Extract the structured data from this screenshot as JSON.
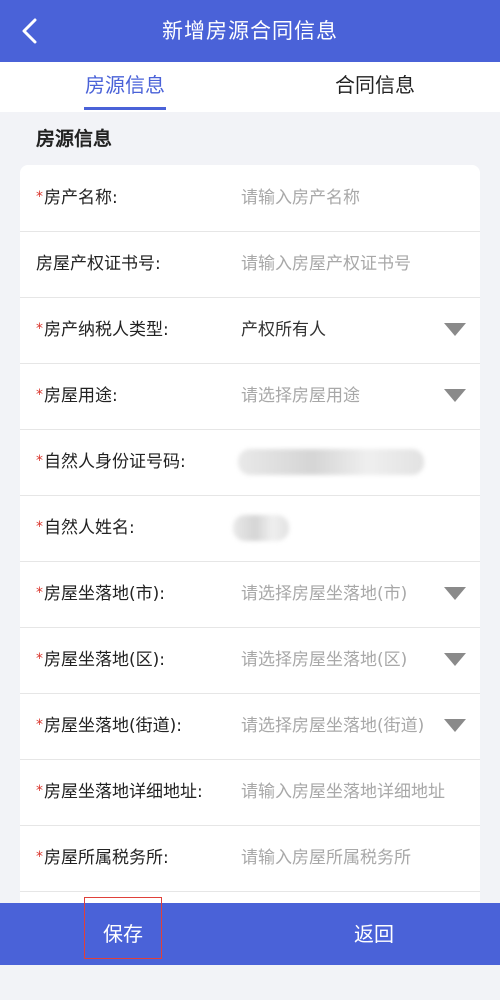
{
  "header": {
    "title": "新增房源合同信息"
  },
  "tabs": [
    {
      "label": "房源信息",
      "active": true
    },
    {
      "label": "合同信息",
      "active": false
    }
  ],
  "section": {
    "title": "房源信息"
  },
  "form": {
    "fields": [
      {
        "label": "房产名称:",
        "required": true,
        "placeholder": "请输入房产名称",
        "value": "",
        "type": "input"
      },
      {
        "label": "房屋产权证书号:",
        "required": false,
        "placeholder": "请输入房屋产权证书号",
        "value": "",
        "type": "input"
      },
      {
        "label": "房产纳税人类型:",
        "required": true,
        "placeholder": "",
        "value": "产权所有人",
        "type": "select"
      },
      {
        "label": "房屋用途:",
        "required": true,
        "placeholder": "请选择房屋用途",
        "value": "",
        "type": "select"
      },
      {
        "label": "自然人身份证号码:",
        "required": true,
        "placeholder": "",
        "value": "",
        "type": "input",
        "obscured": true
      },
      {
        "label": "自然人姓名:",
        "required": true,
        "placeholder": "",
        "value": "",
        "type": "input",
        "obscured": true
      },
      {
        "label": "房屋坐落地(市):",
        "required": true,
        "placeholder": "请选择房屋坐落地(市)",
        "value": "",
        "type": "select"
      },
      {
        "label": "房屋坐落地(区):",
        "required": true,
        "placeholder": "请选择房屋坐落地(区)",
        "value": "",
        "type": "select"
      },
      {
        "label": "房屋坐落地(街道):",
        "required": true,
        "placeholder": "请选择房屋坐落地(街道)",
        "value": "",
        "type": "select"
      },
      {
        "label": "房屋坐落地详细地址:",
        "required": true,
        "placeholder": "请输入房屋坐落地详细地址",
        "value": "",
        "type": "input"
      },
      {
        "label": "房屋所属税务所:",
        "required": true,
        "placeholder": "请输入房屋所属税务所",
        "value": "",
        "type": "input"
      }
    ],
    "required_mark": "*"
  },
  "footer": {
    "save_label": "保存",
    "back_label": "返回"
  },
  "colors": {
    "primary": "#4a62d8",
    "required": "#d9342b",
    "highlight": "#e0403a"
  }
}
